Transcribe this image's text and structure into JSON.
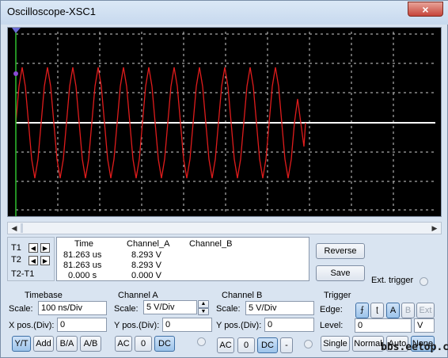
{
  "window": {
    "title": "Oscilloscope-XSC1",
    "close_glyph": "×"
  },
  "screen": {
    "background": "#000000",
    "grid_color": "#cfcfcf",
    "trace_a_color": "#e01c1c",
    "trace_b_color": "#ffffff",
    "cursor_color": "#2fbf2f"
  },
  "cursors": {
    "t1_label": "T1",
    "t2_label": "T2",
    "dt_label": "T2-T1"
  },
  "readout": {
    "headers": [
      "Time",
      "Channel_A",
      "Channel_B"
    ],
    "rows": [
      {
        "time": "81.263 us",
        "a": "8.293 V",
        "b": ""
      },
      {
        "time": "81.263 us",
        "a": "8.293 V",
        "b": ""
      },
      {
        "time": "0.000 s",
        "a": "0.000 V",
        "b": ""
      }
    ]
  },
  "actions": {
    "reverse": "Reverse",
    "save": "Save",
    "ext_trigger": "Ext. trigger"
  },
  "timebase": {
    "heading": "Timebase",
    "scale_label": "Scale:",
    "scale_value": "100 ns/Div",
    "xpos_label": "X pos.(Div):",
    "xpos_value": "0",
    "modes": [
      "Y/T",
      "Add",
      "B/A",
      "A/B"
    ],
    "active_mode": "Y/T"
  },
  "channel_a": {
    "heading": "Channel A",
    "scale_label": "Scale:",
    "scale_value": "5  V/Div",
    "ypos_label": "Y pos.(Div):",
    "ypos_value": "0",
    "coupling": [
      "AC",
      "0",
      "DC"
    ],
    "active": "DC"
  },
  "channel_b": {
    "heading": "Channel B",
    "scale_label": "Scale:",
    "scale_value": "5  V/Div",
    "ypos_label": "Y pos.(Div):",
    "ypos_value": "0",
    "coupling": [
      "AC",
      "0",
      "DC",
      "-"
    ],
    "active": "DC"
  },
  "trigger": {
    "heading": "Trigger",
    "edge_label": "Edge:",
    "edge_sources": [
      "A",
      "B",
      "Ext"
    ],
    "level_label": "Level:",
    "level_value": "0",
    "level_unit": "V",
    "modes": [
      "Single",
      "Normal",
      "Auto",
      "None"
    ],
    "active_mode": "None"
  },
  "watermark": "bbs.eetop.cn"
}
